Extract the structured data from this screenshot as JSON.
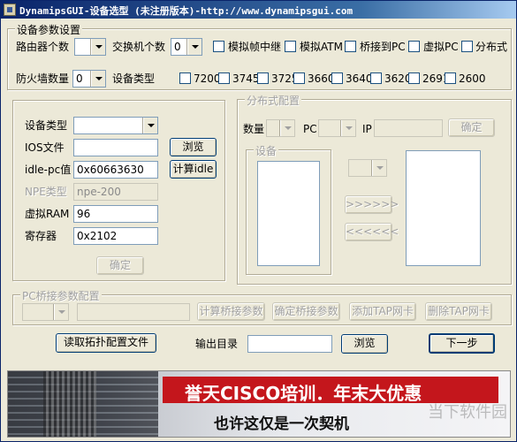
{
  "window": {
    "title": "DynamipsGUI-设备选型 (未注册版本)-http://www.dynamipsgui.com"
  },
  "device_settings": {
    "group_title": "设备参数设置",
    "router_count_label": "路由器个数",
    "router_count_value": "",
    "switch_count_label": "交换机个数",
    "switch_count_value": "0",
    "checkboxes": [
      "模拟帧中继",
      "模拟ATM",
      "桥接到PC",
      "虚拟PC",
      "分布式"
    ],
    "firewall_count_label": "防火墙数量",
    "firewall_count_value": "0",
    "device_type_label": "设备类型",
    "models": [
      "7200",
      "3745",
      "3725",
      "3660",
      "3640",
      "3620",
      "2691",
      "2600"
    ]
  },
  "device_panel": {
    "device_type_label": "设备类型",
    "device_type_value": "",
    "ios_label": "IOS文件",
    "ios_value": "",
    "browse_label": "浏览",
    "idle_label": "idle-pc值",
    "idle_value": "0x60663630",
    "calc_idle_label": "计算idle",
    "npe_label": "NPE类型",
    "npe_value": "npe-200",
    "ram_label": "虚拟RAM",
    "ram_value": "96",
    "reg_label": "寄存器",
    "reg_value": "0x2102",
    "ok_label": "确定"
  },
  "distributed": {
    "group_title": "分布式配置",
    "count_label": "数量",
    "pc_label": "PC",
    "ip_label": "IP",
    "ok_label": "确定",
    "device_group_title": "设备",
    "forward_label": ">>>>>>",
    "back_label": "<<<<<<"
  },
  "bridge": {
    "group_title": "PC桥接参数配置",
    "calc_label": "计算桥接参数",
    "confirm_label": "确定桥接参数",
    "add_tap_label": "添加TAP网卡",
    "del_tap_label": "删除TAP网卡"
  },
  "footer": {
    "read_topology_label": "读取拓扑配置文件",
    "output_dir_label": "输出目录",
    "output_dir_value": "",
    "browse_label": "浏览",
    "next_label": "下一步"
  },
  "banner": {
    "line1": "誉天CISCO培训．年末大优惠",
    "line2": "也许这仅是一次契机",
    "watermark": "当下软件园"
  }
}
